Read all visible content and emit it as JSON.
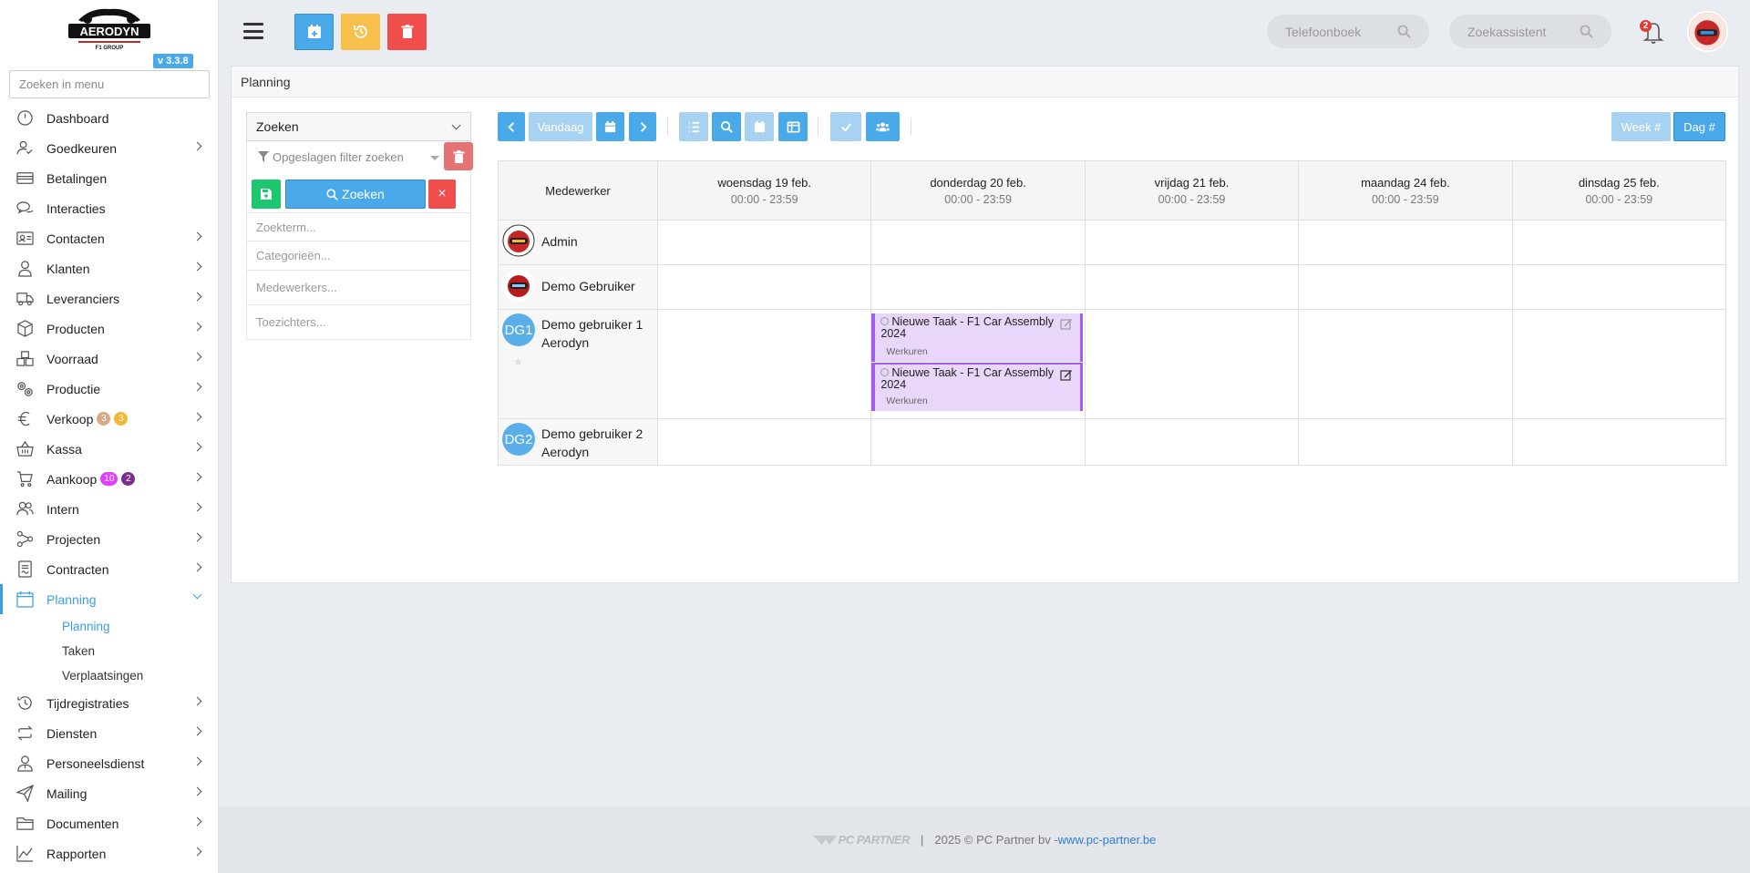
{
  "sidebar": {
    "version": "v 3.3.8",
    "search_placeholder": "Zoeken in menu",
    "items": [
      {
        "label": "Dashboard",
        "icon": "dashboard-icon"
      },
      {
        "label": "Goedkeuren",
        "icon": "user-check-icon"
      },
      {
        "label": "Betalingen",
        "icon": "credit-card-icon"
      },
      {
        "label": "Interacties",
        "icon": "chat-icon"
      },
      {
        "label": "Contacten",
        "icon": "contact-card-icon"
      },
      {
        "label": "Klanten",
        "icon": "person-icon"
      },
      {
        "label": "Leveranciers",
        "icon": "truck-icon"
      },
      {
        "label": "Producten",
        "icon": "box-icon"
      },
      {
        "label": "Voorraad",
        "icon": "stock-icon"
      },
      {
        "label": "Productie",
        "icon": "gears-icon"
      },
      {
        "label": "Verkoop",
        "icon": "euro-icon",
        "badges": [
          "3",
          "3"
        ]
      },
      {
        "label": "Kassa",
        "icon": "basket-icon"
      },
      {
        "label": "Aankoop",
        "icon": "cart-icon",
        "badges": [
          "10",
          "2"
        ]
      },
      {
        "label": "Intern",
        "icon": "users-icon"
      },
      {
        "label": "Projecten",
        "icon": "project-icon"
      },
      {
        "label": "Contracten",
        "icon": "contract-icon"
      },
      {
        "label": "Planning",
        "icon": "calendar-icon",
        "active": true
      },
      {
        "label": "Tijdregistraties",
        "icon": "history-icon"
      },
      {
        "label": "Diensten",
        "icon": "repeat-icon"
      },
      {
        "label": "Personeelsdienst",
        "icon": "staff-icon"
      },
      {
        "label": "Mailing",
        "icon": "send-icon"
      },
      {
        "label": "Documenten",
        "icon": "folder-icon"
      },
      {
        "label": "Rapporten",
        "icon": "chart-icon"
      }
    ],
    "submenu": [
      "Planning",
      "Taken",
      "Verplaatsingen"
    ]
  },
  "topbar": {
    "phonebook_placeholder": "Telefoonboek",
    "assistant_placeholder": "Zoekassistent",
    "notification_count": "2"
  },
  "panel": {
    "title": "Planning"
  },
  "filter": {
    "select_label": "Zoeken",
    "saved_filter_placeholder": "Opgeslagen filter zoeken",
    "search_button": "Zoeken",
    "close_glyph": "×",
    "fields": [
      "Zoekterm...",
      "Categorieën...",
      "Medewerkers...",
      "Toezichters..."
    ]
  },
  "toolbar": {
    "today_label": "Vandaag",
    "week_label": "Week #",
    "day_label": "Dag #"
  },
  "calendar": {
    "employee_header": "Medewerker",
    "days": [
      {
        "label": "woensdag 19 feb.",
        "time": "00:00 - 23:59"
      },
      {
        "label": "donderdag 20 feb.",
        "time": "00:00 - 23:59"
      },
      {
        "label": "vrijdag 21 feb.",
        "time": "00:00 - 23:59"
      },
      {
        "label": "maandag 24 feb.",
        "time": "00:00 - 23:59"
      },
      {
        "label": "dinsdag 25 feb.",
        "time": "00:00 - 23:59"
      }
    ],
    "employees": [
      {
        "name": "Admin",
        "avatar": "image"
      },
      {
        "name": "Demo Gebruiker",
        "avatar": "image"
      },
      {
        "name": "Demo gebruiker 1 Aerodyn",
        "avatar": "DG1"
      },
      {
        "name": "Demo gebruiker 2 Aerodyn",
        "avatar": "DG2"
      }
    ],
    "tasks": [
      {
        "title": "Nieuwe Taak - F1 Car Assembly 2024",
        "category": "Werkuren"
      },
      {
        "title": "Nieuwe Taak - F1 Car Assembly 2024",
        "category": "Werkuren"
      }
    ]
  },
  "footer": {
    "brand": "PC PARTNER",
    "separator": "|",
    "copyright": "2025 © PC Partner bv - ",
    "link": "www.pc-partner.be"
  },
  "colors": {
    "accent": "#3b9ee4",
    "warning": "#f7c04a",
    "danger": "#f04d4d",
    "success": "#1ec76f",
    "task": "#a45cf0"
  }
}
